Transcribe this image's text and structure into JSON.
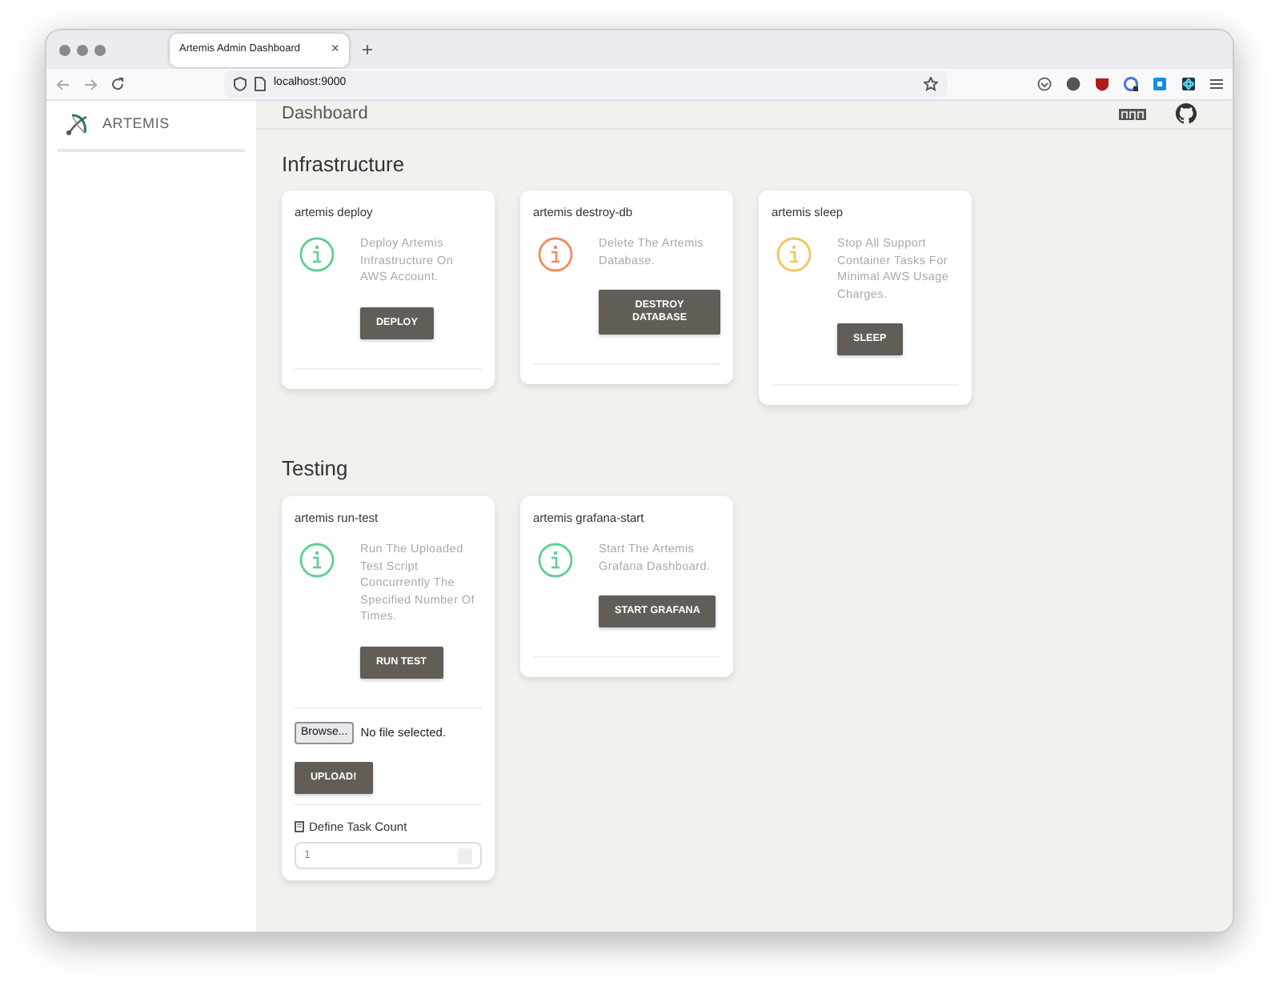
{
  "browser": {
    "tab_title": "Artemis Admin Dashboard",
    "tab_close": "×",
    "new_tab": "+",
    "url": "localhost:9000"
  },
  "sidebar": {
    "brand": "ARTEMIS"
  },
  "header": {
    "title": "Dashboard"
  },
  "sections": [
    {
      "title": "Infrastructure",
      "cards": [
        {
          "title": "artemis deploy",
          "description": "Deploy Artemis Infrastructure On AWS Account.",
          "button": "DEPLOY",
          "color": "#5fcf8e"
        },
        {
          "title": "artemis destroy-db",
          "description": "Delete The Artemis Database.",
          "button": "DESTROY DATABASE",
          "color": "#f08a5d"
        },
        {
          "title": "artemis sleep",
          "description": "Stop All Support Container Tasks For Minimal AWS Usage Charges.",
          "button": "SLEEP",
          "color": "#f7c35f"
        }
      ]
    },
    {
      "title": "Testing",
      "cards": [
        {
          "title": "artemis run-test",
          "description": "Run The Uploaded Test Script Concurrently The Specified Number Of Times.",
          "button": "RUN TEST",
          "color": "#5fcf8e",
          "upload": {
            "browse": "Browse...",
            "file_status": "No file selected.",
            "button": "UPLOAD!"
          },
          "task_count": {
            "label": "Define Task Count",
            "value": "1"
          }
        },
        {
          "title": "artemis grafana-start",
          "description": "Start The Artemis Grafana Dashboard.",
          "button": "START GRAFANA",
          "color": "#5fcf8e"
        }
      ]
    }
  ]
}
